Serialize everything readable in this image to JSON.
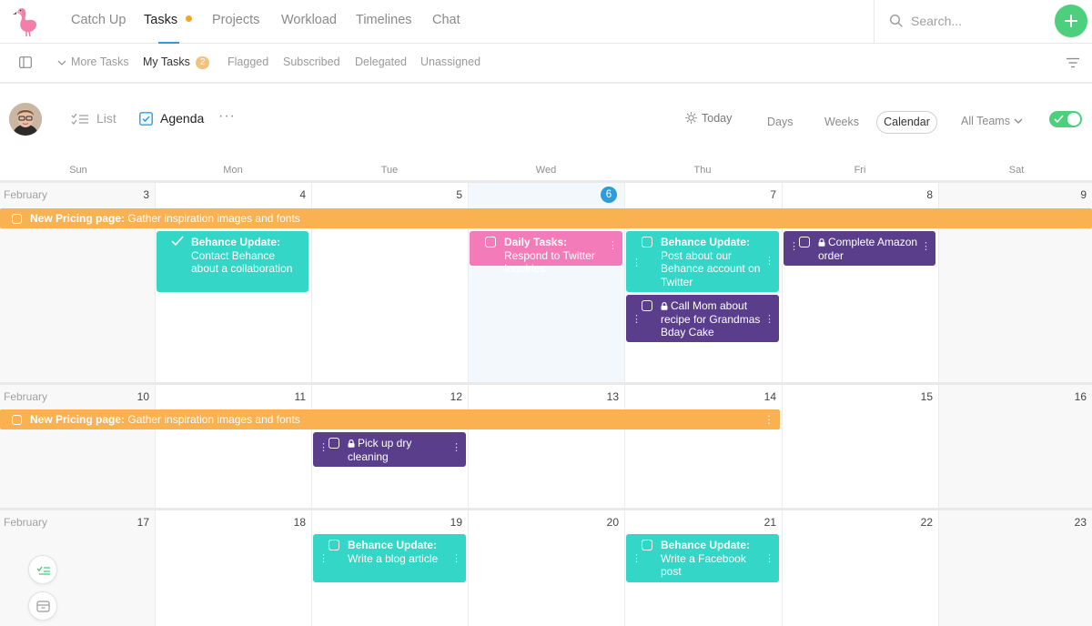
{
  "nav": {
    "tabs": [
      {
        "label": "Catch Up"
      },
      {
        "label": "Tasks"
      },
      {
        "label": "Projects"
      },
      {
        "label": "Workload"
      },
      {
        "label": "Timelines"
      },
      {
        "label": "Chat"
      }
    ],
    "active_tab": "Tasks",
    "search_placeholder": "Search..."
  },
  "subnav": {
    "more_tasks": "More Tasks",
    "items": [
      "My Tasks",
      "Flagged",
      "Subscribed",
      "Delegated",
      "Unassigned"
    ],
    "my_tasks_count": "2"
  },
  "toolbar": {
    "list_label": "List",
    "agenda_label": "Agenda",
    "more": "···",
    "today_label": "Today",
    "days_label": "Days",
    "weeks_label": "Weeks",
    "calendar_label": "Calendar",
    "teams_label": "All Teams",
    "toggle_on": true
  },
  "calendar": {
    "weekdays": [
      "Sun",
      "Mon",
      "Tue",
      "Wed",
      "Thu",
      "Fri",
      "Sat"
    ],
    "month": "February",
    "weeks": [
      {
        "days": [
          "3",
          "4",
          "5",
          "6",
          "7",
          "8",
          "9"
        ]
      },
      {
        "days": [
          "10",
          "11",
          "12",
          "13",
          "14",
          "15",
          "16"
        ]
      },
      {
        "days": [
          "17",
          "18",
          "19",
          "20",
          "21",
          "22",
          "23"
        ]
      }
    ],
    "today": "6",
    "banners": [
      {
        "bold": "New Pricing page:",
        "text": " Gather inspiration images and fonts"
      },
      {
        "bold": "New Pricing page:",
        "text": " Gather inspiration images and fonts"
      }
    ],
    "tasks": {
      "w1_mon": {
        "bold": "Behance Update:",
        "text": " Contact Behance about a collaboration",
        "color": "#33d6c7",
        "done": true
      },
      "w1_wed": {
        "bold": "Daily Tasks:",
        "text": " Respond to Twitter Inquiries",
        "color": "#f47bb9"
      },
      "w1_thu_a": {
        "bold": "Behance Update:",
        "text": " Post about our Behance account on Twitter",
        "color": "#33d6c7"
      },
      "w1_thu_b": {
        "text": "Call Mom about recipe for Grandmas Bday Cake",
        "color": "#5a3e8c",
        "locked": true
      },
      "w1_fri": {
        "text": "Complete Amazon order",
        "color": "#5a3e8c",
        "locked": true
      },
      "w2_tue": {
        "text": "Pick up dry cleaning",
        "color": "#5a3e8c",
        "locked": true
      },
      "w3_tue": {
        "bold": "Behance Update:",
        "text": " Write a blog article",
        "color": "#33d6c7"
      },
      "w3_thu": {
        "bold": "Behance Update:",
        "text": " Write a Facebook post",
        "color": "#33d6c7"
      }
    }
  },
  "colors": {
    "accent": "#2d9cdb",
    "green": "#4cd07d",
    "orange": "#f9b152",
    "teal": "#33d6c7",
    "purple": "#5a3e8c",
    "pink": "#f47bb9"
  },
  "icons": [
    "flamingo-logo-icon",
    "search-icon",
    "plus-icon",
    "sidebar-panel-icon",
    "chevron-down-icon",
    "filter-icon",
    "list-check-icon",
    "agenda-check-icon",
    "sun-icon",
    "lock-icon",
    "checkmark-icon",
    "tasks-fab-icon",
    "inbox-fab-icon"
  ]
}
